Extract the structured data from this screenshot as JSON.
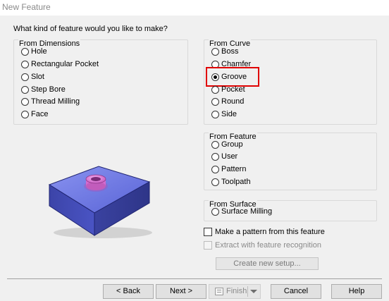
{
  "window": {
    "title": "New Feature"
  },
  "question": "What kind of feature would you like to make?",
  "from_dimensions": {
    "title": "From Dimensions",
    "options": [
      "Hole",
      "Rectangular Pocket",
      "Slot",
      "Step Bore",
      "Thread Milling",
      "Face"
    ]
  },
  "from_curve": {
    "title": "From Curve",
    "options": [
      "Boss",
      "Chamfer",
      "Groove",
      "Pocket",
      "Round",
      "Side"
    ],
    "selected": "Groove"
  },
  "from_feature": {
    "title": "From Feature",
    "options": [
      "Group",
      "User",
      "Pattern",
      "Toolpath"
    ]
  },
  "from_surface": {
    "title": "From Surface",
    "options": [
      "Surface Milling"
    ]
  },
  "checkboxes": {
    "make_pattern": "Make a pattern from this feature",
    "extract_recognition": "Extract with feature recognition"
  },
  "create_setup_label": "Create new setup...",
  "buttons": {
    "back": "< Back",
    "next": "Next >",
    "finish": "Finish",
    "cancel": "Cancel",
    "help": "Help"
  },
  "colors": {
    "highlight": "#e00000",
    "block": "#5f6ad4",
    "boss": "#e07bd8"
  }
}
